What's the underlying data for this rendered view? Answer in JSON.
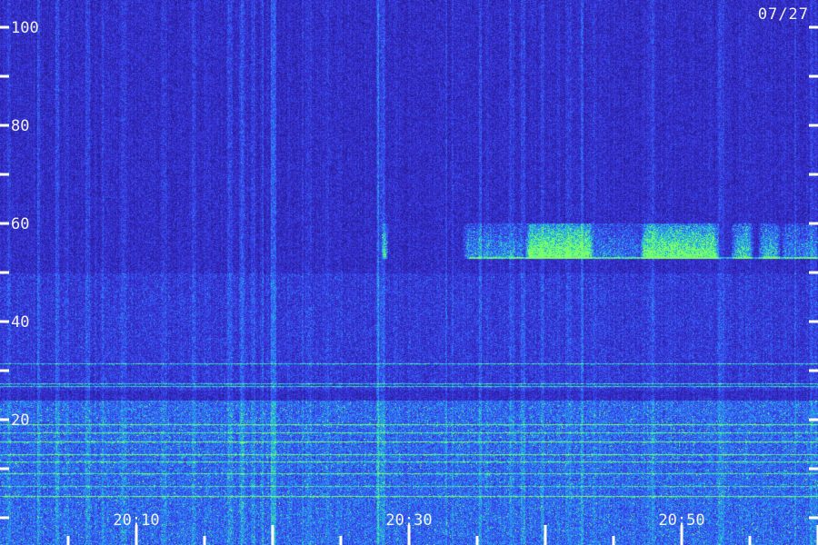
{
  "chart_data": {
    "type": "heatmap",
    "date_label": "07/27",
    "y_axis": {
      "ticks": [
        100,
        80,
        60,
        40,
        20
      ],
      "tick_labels": [
        "100",
        "80",
        "60",
        "40",
        "20"
      ],
      "minor_ticks": [
        90,
        70,
        50,
        30,
        10,
        0
      ],
      "range": [
        0,
        100
      ]
    },
    "x_axis": {
      "ticks": [
        "20:10",
        "20:30",
        "20:50"
      ],
      "range": [
        "20:02",
        "21:02"
      ]
    },
    "colormap": [
      "#1a0f5e",
      "#2a1fa0",
      "#3b35e0",
      "#2f7cff",
      "#1fd0c8",
      "#7cff6a"
    ],
    "features": [
      {
        "name": "emission-band-upper",
        "freq_range": [
          53,
          60
        ],
        "time_range": [
          "20:50",
          "21:00"
        ],
        "intensity": "high"
      },
      {
        "name": "emission-band-lower",
        "freq_range": [
          5,
          26
        ],
        "time_range": [
          "20:02",
          "21:02"
        ],
        "intensity": "medium"
      }
    ]
  }
}
